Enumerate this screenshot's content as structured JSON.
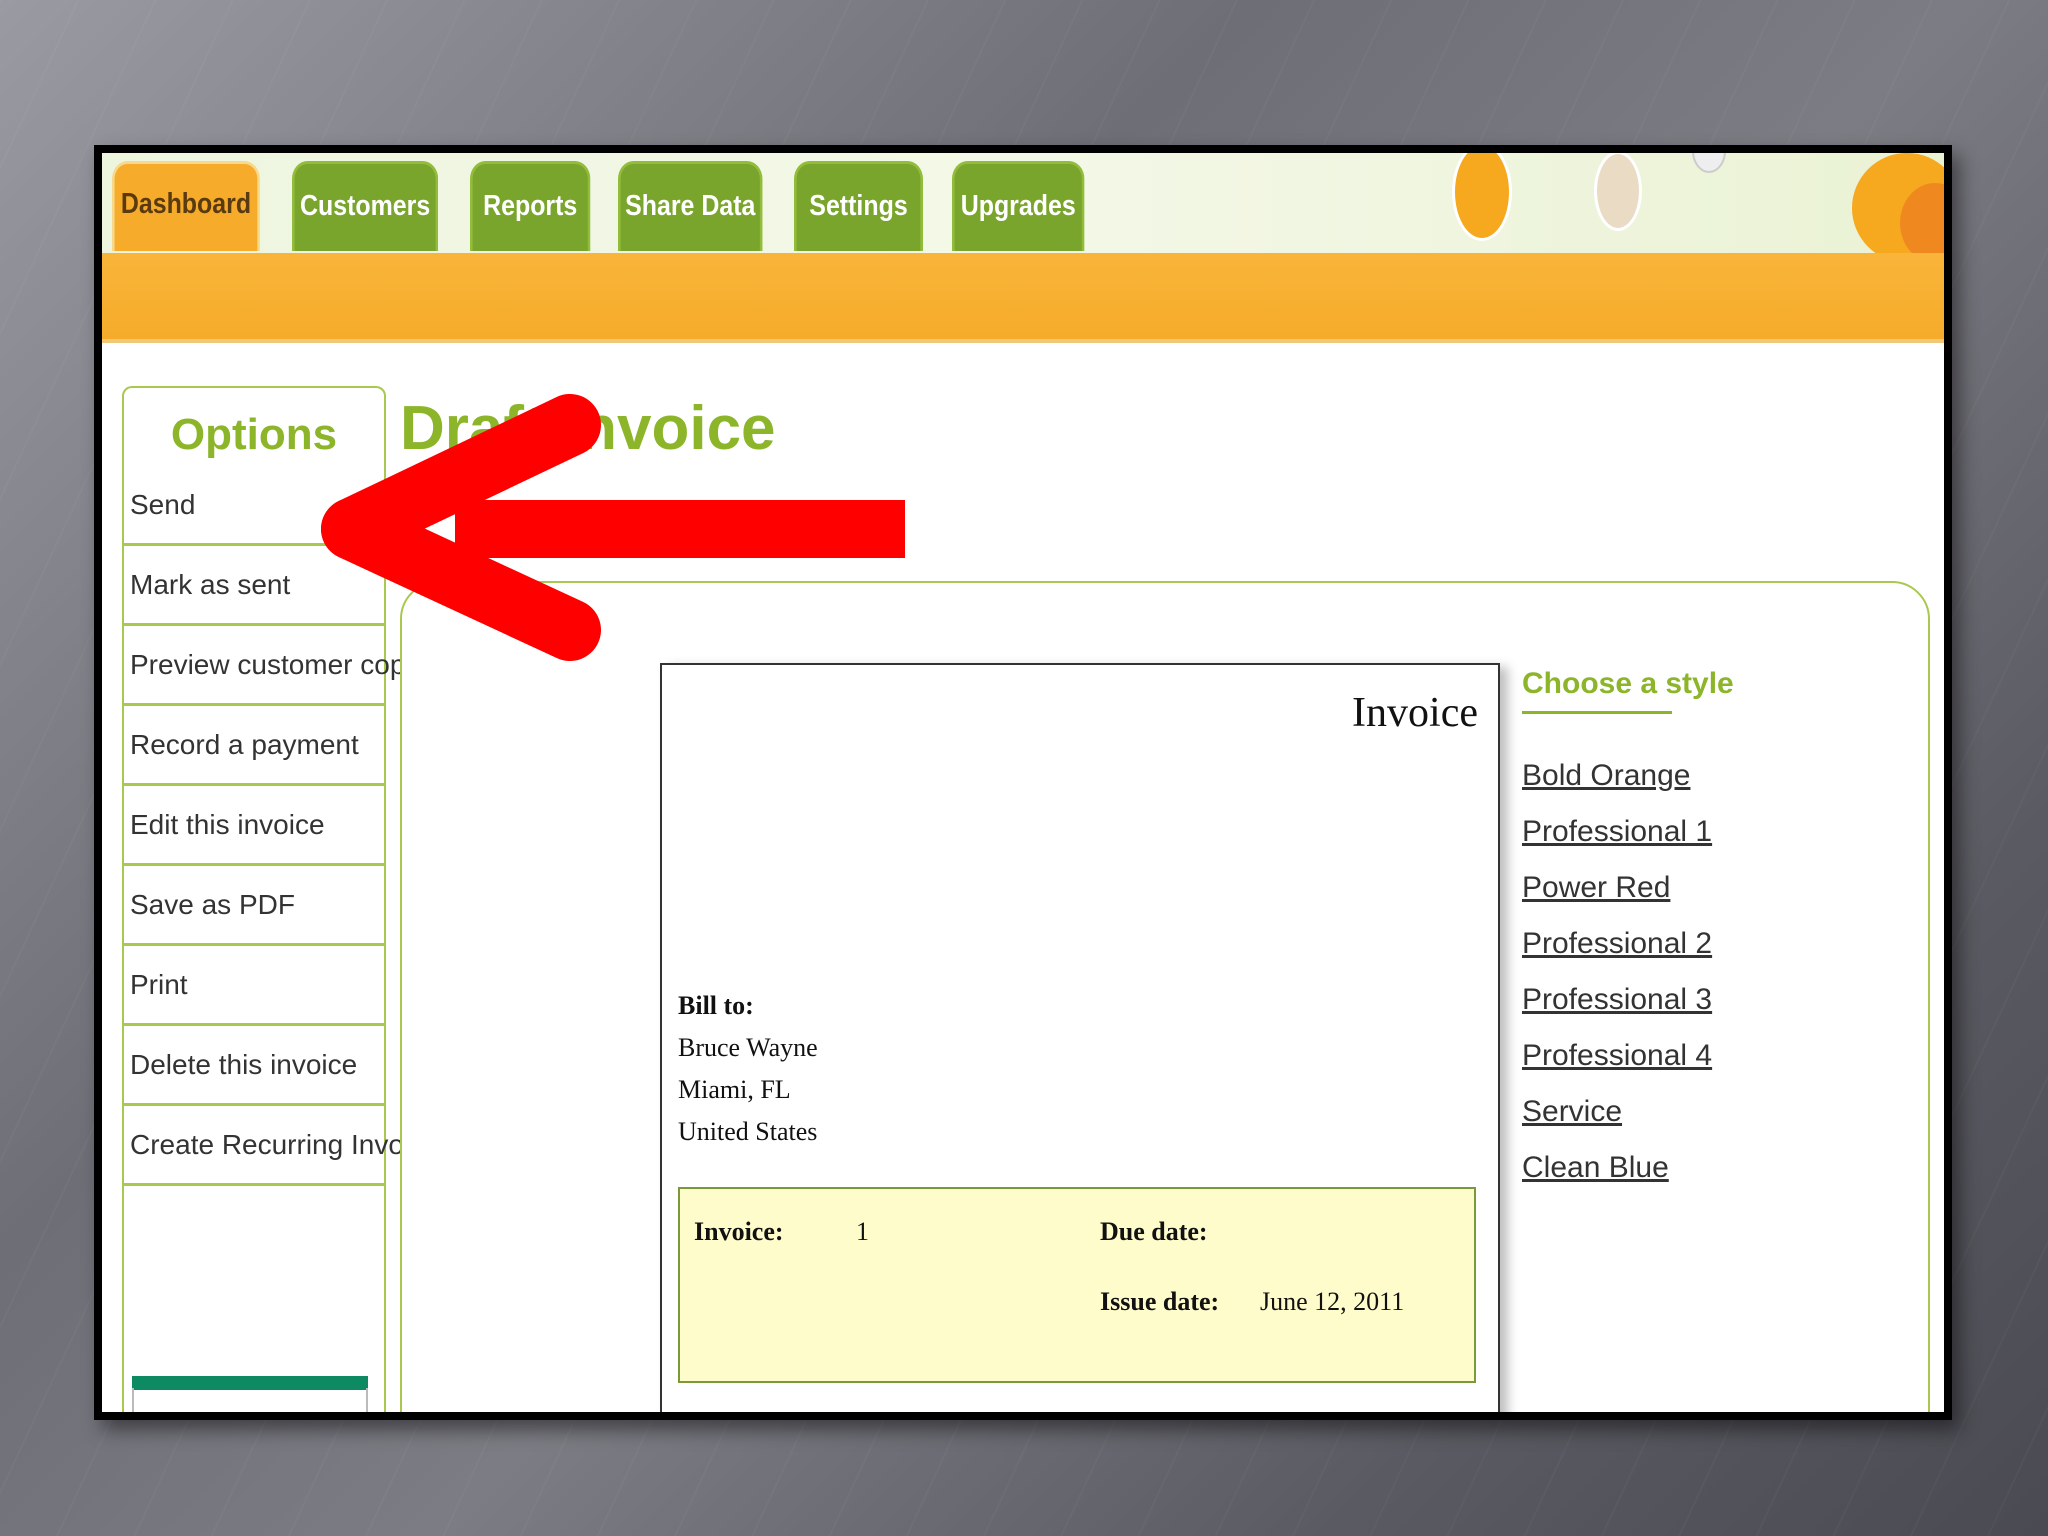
{
  "tabs": [
    {
      "label": "Dashboard",
      "active": true
    },
    {
      "label": "Customers",
      "active": false
    },
    {
      "label": "Reports",
      "active": false
    },
    {
      "label": "Share Data",
      "active": false
    },
    {
      "label": "Settings",
      "active": false
    },
    {
      "label": "Upgrades",
      "active": false
    }
  ],
  "sidebar": {
    "title": "Options",
    "items": [
      "Send",
      "Mark as sent",
      "Preview customer copy",
      "Record a payment",
      "Edit this invoice",
      "Save as PDF",
      "Print",
      "Delete this invoice",
      "Create Recurring Invoice"
    ]
  },
  "page": {
    "title": "Draft Invoice"
  },
  "invoice": {
    "heading": "Invoice",
    "bill_to_label": "Bill to:",
    "bill_to": [
      "Bruce Wayne",
      "Miami, FL",
      "United States"
    ],
    "invoice_label": "Invoice:",
    "invoice_number": "1",
    "due_date_label": "Due date:",
    "due_date": "",
    "issue_date_label": "Issue date:",
    "issue_date": "June 12, 2011"
  },
  "styles": {
    "title": "Choose a style",
    "items": [
      "Bold Orange",
      "Professional 1",
      "Power Red",
      "Professional 2",
      "Professional 3",
      "Professional 4",
      "Service",
      "Clean Blue"
    ]
  },
  "colors": {
    "accent_green": "#8cb52a",
    "tab_green": "#7aa52d",
    "orange": "#f6ab2a",
    "arrow_red": "#ff0000",
    "invoice_box": "#fffccc"
  }
}
